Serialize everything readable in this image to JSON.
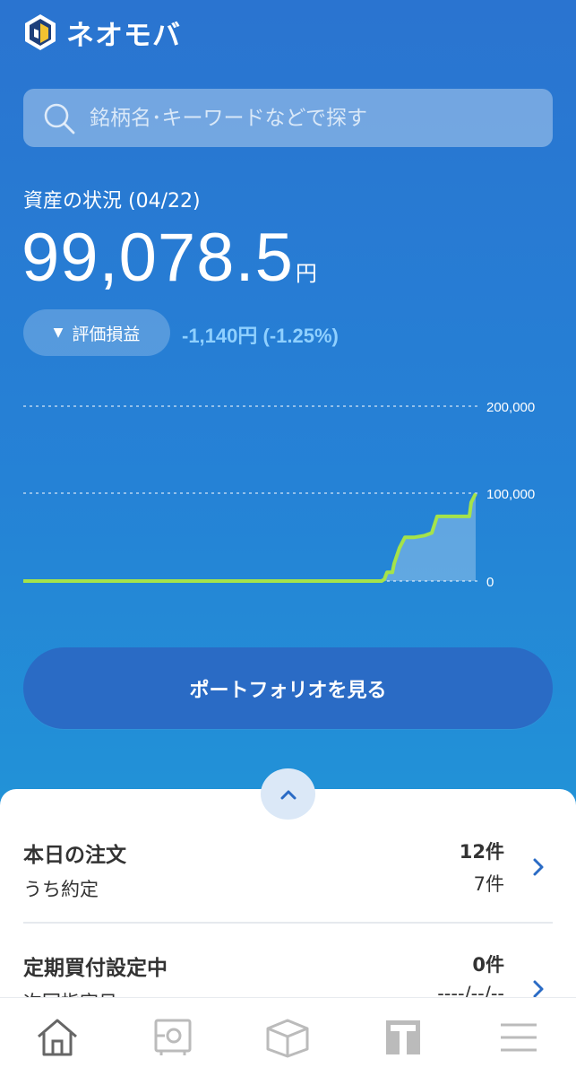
{
  "app": {
    "name": "ネオモバ"
  },
  "search": {
    "placeholder": "銘柄名･キーワードなどで探す"
  },
  "assets": {
    "label": "資産の状況 (04/22)",
    "value": "99,078.5",
    "unit": "円",
    "eval_label": "評価損益",
    "eval_value": "-1,140円 (-1.25%)"
  },
  "chart_data": {
    "type": "area",
    "ylim": [
      0,
      200000
    ],
    "y_ticks": [
      "200,000",
      "100,000",
      "0"
    ],
    "points": [
      [
        0,
        0
      ],
      [
        400,
        0
      ],
      [
        403,
        2000
      ],
      [
        406,
        10000
      ],
      [
        412,
        10000
      ],
      [
        414,
        20000
      ],
      [
        418,
        32000
      ],
      [
        420,
        38000
      ],
      [
        426,
        50000
      ],
      [
        436,
        50000
      ],
      [
        448,
        52000
      ],
      [
        456,
        55000
      ],
      [
        462,
        74000
      ],
      [
        498,
        74000
      ],
      [
        500,
        90000
      ],
      [
        505,
        100000
      ]
    ],
    "colors": {
      "line": "#a5e34a",
      "fill": "rgba(255,255,255,0.28)"
    }
  },
  "portfolio_button": {
    "label": "ポートフォリオを見る"
  },
  "orders": {
    "title": "本日の注文",
    "subtitle": "うち約定",
    "count": "12件",
    "filled": "7件"
  },
  "recurring": {
    "title": "定期買付設定中",
    "subtitle": "次回指定日",
    "count": "0件",
    "next": "----/--/--"
  },
  "tabs": [
    {
      "icon": "home-icon"
    },
    {
      "icon": "safe-icon"
    },
    {
      "icon": "box-icon"
    },
    {
      "icon": "t-icon"
    },
    {
      "icon": "menu-icon"
    }
  ]
}
